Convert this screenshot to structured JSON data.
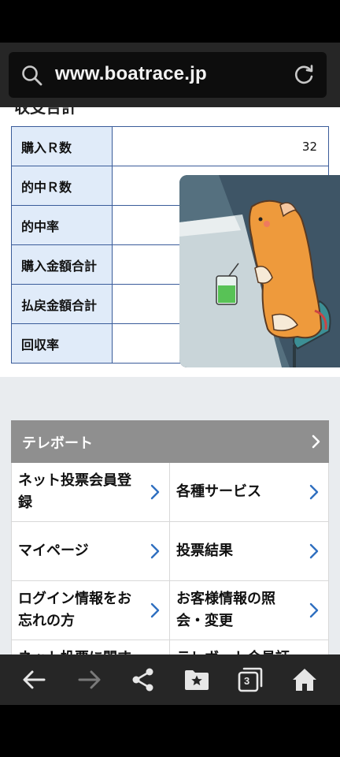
{
  "browser": {
    "url": "www.boatrace.jp"
  },
  "stats": {
    "section_title_cut": "収支合計",
    "rows": [
      {
        "label": "購入Ｒ数",
        "value": "32"
      },
      {
        "label": "的中Ｒ数",
        "value": ""
      },
      {
        "label": "的中率",
        "value": ""
      },
      {
        "label": "購入金額合計",
        "value": ""
      },
      {
        "label": "払戻金額合計",
        "value": ""
      },
      {
        "label": "回収率",
        "value": ""
      }
    ]
  },
  "teleport": {
    "title": "テレボート",
    "items": [
      {
        "label": "ネット投票会員登録"
      },
      {
        "label": "各種サービス"
      },
      {
        "label": "マイページ"
      },
      {
        "label": "投票結果"
      },
      {
        "label": "ログイン情報をお忘れの方"
      },
      {
        "label": "お客様情報の照会・変更"
      },
      {
        "label": "ネット投票に関するお問い合わせ"
      },
      {
        "label": "テレボート会員証"
      }
    ]
  },
  "bottom_nav": {
    "tab_count": "3",
    "icons": [
      "back-arrow-icon",
      "forward-arrow-icon",
      "share-icon",
      "bookmark-icon",
      "tabs-icon",
      "home-icon"
    ]
  },
  "colors": {
    "table_border": "#3a5c9a",
    "label_bg": "#e0ebf9",
    "teleport_header": "#8f8f8f",
    "arrow_blue": "#2f6fc0"
  }
}
